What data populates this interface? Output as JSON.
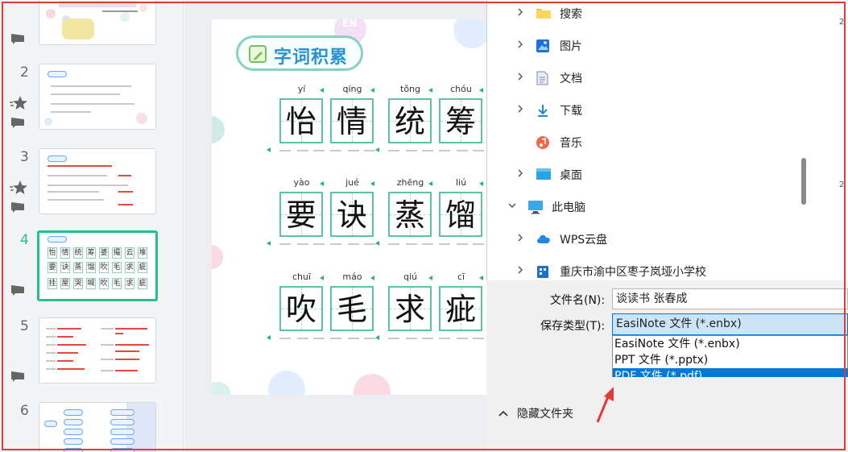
{
  "slides_panel": {
    "items": [
      {
        "number": ""
      },
      {
        "number": "2"
      },
      {
        "number": "3"
      },
      {
        "number": "4",
        "active": true
      },
      {
        "number": "5"
      },
      {
        "number": "6"
      }
    ],
    "slide4_chars": [
      "怡",
      "情",
      "统",
      "筹",
      "婆",
      "撮",
      "云",
      "堆",
      "要",
      "诀",
      "蒸",
      "馏",
      "吹",
      "毛",
      "求",
      "疵",
      "挂",
      "屋",
      "哭",
      "喊",
      "吹",
      "毛",
      "求",
      "疵",
      "纵",
      "横",
      "昼",
      "夜"
    ]
  },
  "slide": {
    "title": "字词积累",
    "corner_badge": "EN",
    "cards": [
      {
        "pinyin": [
          "yí",
          "qíng"
        ],
        "chars": [
          "怡",
          "情"
        ]
      },
      {
        "pinyin": [
          "tǒng",
          "chóu"
        ],
        "chars": [
          "统",
          "筹"
        ]
      },
      {
        "pinyin": [
          "yào",
          "jué"
        ],
        "chars": [
          "要",
          "诀"
        ]
      },
      {
        "pinyin": [
          "zhēng",
          "liú"
        ],
        "chars": [
          "蒸",
          "馏"
        ]
      },
      {
        "pinyin": [
          "chuī",
          "máo"
        ],
        "chars": [
          "吹",
          "毛"
        ]
      },
      {
        "pinyin": [
          "qiú",
          "cī"
        ],
        "chars": [
          "求",
          "疵"
        ]
      }
    ]
  },
  "dialog": {
    "nav": [
      {
        "label": "搜索",
        "icon": "folder-icon",
        "expandable": true,
        "indent": 1
      },
      {
        "label": "图片",
        "icon": "pictures-icon",
        "expandable": true,
        "indent": 1
      },
      {
        "label": "文档",
        "icon": "documents-icon",
        "expandable": true,
        "indent": 1
      },
      {
        "label": "下载",
        "icon": "download-icon",
        "expandable": true,
        "indent": 1
      },
      {
        "label": "音乐",
        "icon": "music-icon",
        "expandable": false,
        "indent": 1
      },
      {
        "label": "桌面",
        "icon": "desktop-icon",
        "expandable": true,
        "indent": 1
      },
      {
        "label": "此电脑",
        "icon": "computer-icon",
        "expandable": true,
        "expanded": true,
        "indent": 0
      },
      {
        "label": "WPS云盘",
        "icon": "cloud-icon",
        "expandable": true,
        "indent": 1
      },
      {
        "label": "重庆市渝中区枣子岚垭小学校",
        "icon": "org-drive-icon",
        "expandable": true,
        "indent": 1
      }
    ],
    "filename_label": "文件名(N):",
    "filename_value": "谈读书 张春成",
    "filetype_label": "保存类型(T):",
    "filetype_value": "EasiNote 文件 (*.enbx)",
    "filetype_options": [
      {
        "label": "EasiNote 文件 (*.enbx)",
        "selected": false
      },
      {
        "label": "PPT 文件 (*.pptx)",
        "selected": false
      },
      {
        "label": "PDF 文件 (*.pdf)",
        "selected": true
      }
    ],
    "hide_folders_label": "隐藏文件夹",
    "edge_digits": [
      "2",
      "2"
    ]
  },
  "colors": {
    "accent_green": "#22c28b",
    "selection_blue": "#0078d7",
    "annotation_red": "#e53935"
  }
}
